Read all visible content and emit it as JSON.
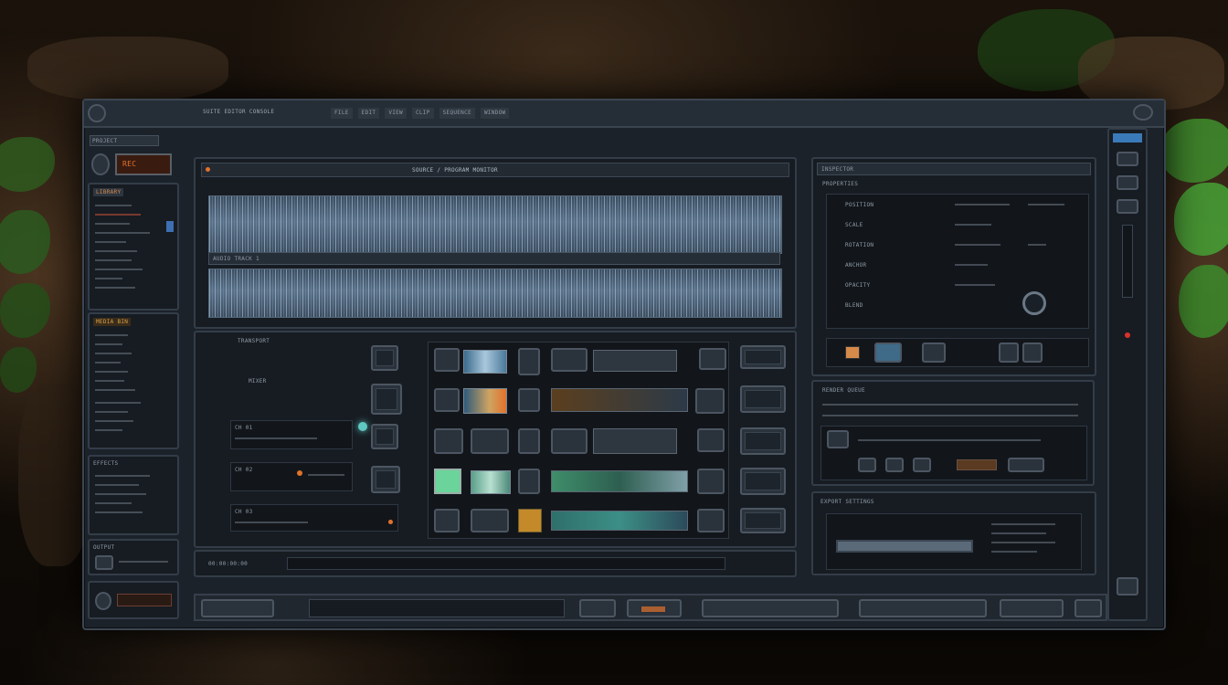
{
  "window": {
    "title": "SUITE EDITOR CONSOLE",
    "menu": [
      "FILE",
      "EDIT",
      "VIEW",
      "CLIP",
      "SEQUENCE",
      "WINDOW"
    ]
  },
  "left_panel": {
    "top_label": "PROJECT",
    "record_label": "REC",
    "section1": "LIBRARY",
    "section2": "MEDIA BIN",
    "section3": "EFFECTS",
    "section4": "OUTPUT"
  },
  "timeline": {
    "header": "SOURCE / PROGRAM MONITOR",
    "track_label": "AUDIO TRACK 1",
    "footer": "00:00:00:00"
  },
  "control_grid": {
    "label1": "TRANSPORT",
    "label2": "MIXER",
    "rows": [
      "CH 01",
      "CH 02",
      "CH 03"
    ]
  },
  "inspector": {
    "title": "INSPECTOR",
    "subtitle": "PROPERTIES",
    "rows": [
      "POSITION",
      "SCALE",
      "ROTATION",
      "ANCHOR",
      "OPACITY",
      "BLEND"
    ]
  },
  "bottom_right": {
    "label": "RENDER QUEUE",
    "label2": "EXPORT SETTINGS"
  },
  "colors": {
    "accent_orange": "#e2722c",
    "accent_teal": "#5fc9c2",
    "accent_green": "#6bd49a",
    "red_led": "#d9322a"
  }
}
